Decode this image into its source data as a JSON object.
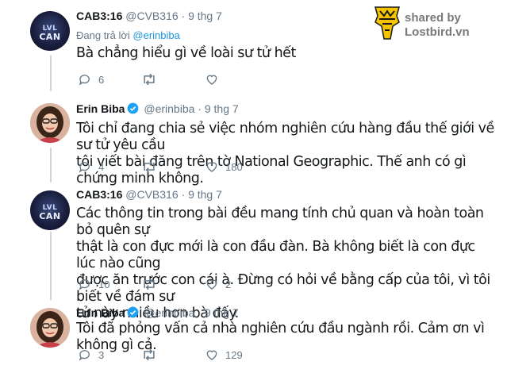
{
  "branding": {
    "shared_by": "shared by",
    "site": "Lostbird.vn",
    "logo_icon": "lostbird-logo-icon",
    "brand_color": "#f4c400"
  },
  "avatars": {
    "cvb_logo_top": "LVL",
    "cvb_logo_main": "CAN"
  },
  "tweets": [
    {
      "name": "CAB3:16",
      "handle": "@CVB316",
      "date": "9 thg 7",
      "replying_prefix": "Đang trả lời",
      "replying_to": "@erinbiba",
      "text": "Bà chẳng hiểu gì về loài sư tử hết",
      "reply_count": "6",
      "retweet_count": "",
      "like_count": ""
    },
    {
      "name": "Erin Biba",
      "handle": "@erinbiba",
      "date": "9 thg 7",
      "verified": true,
      "text_lines": [
        "Tôi chỉ đang chia sẻ việc nhóm nghiên cứu hàng đầu thế giới về sư tử yêu cầu",
        "tôi viết bài đăng trên tờ National Geographic. Thế anh có gì chứng minh không."
      ],
      "reply_count": "4",
      "retweet_count": "",
      "like_count": "180"
    },
    {
      "name": "CAB3:16",
      "handle": "@CVB316",
      "date": "9 thg 7",
      "text_lines": [
        "Các thông tin trong bài đều mang tính chủ quan và hoàn toàn bỏ quên sự",
        "thật là con đực mới là con đầu đàn. Bà không biết là con đực lúc nào cũng",
        "được ăn trước con cái à. Đừng có hỏi về bằng cấp của tôi, vì tôi biết về đám sư",
        "tử này nhiều hơn bà đấy."
      ],
      "reply_count": "10",
      "retweet_count": "",
      "like_count": "2"
    },
    {
      "name": "Erin Biba",
      "handle": "@erinbiba",
      "date": "9 thg 7",
      "verified": true,
      "text": "Tôi đã phỏng vấn cả nhà nghiên cứu  đầu ngành rồi. Cảm ơn vì không gì cả.",
      "reply_count": "3",
      "retweet_count": "",
      "like_count": "129"
    }
  ],
  "colors": {
    "verified": "#1da1f2",
    "link": "#1b95e0",
    "muted": "#657786",
    "thread_line": "#ccd6dd"
  }
}
